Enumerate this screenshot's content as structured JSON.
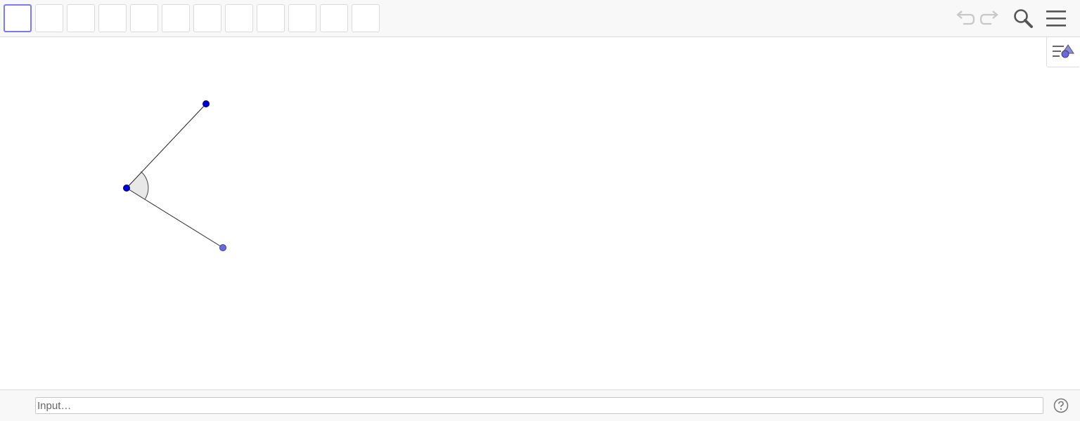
{
  "toolbar": {
    "tools": [
      {
        "name": "tool-1",
        "selected": true
      },
      {
        "name": "tool-2",
        "selected": false
      },
      {
        "name": "tool-3",
        "selected": false
      },
      {
        "name": "tool-4",
        "selected": false
      },
      {
        "name": "tool-5",
        "selected": false
      },
      {
        "name": "tool-6",
        "selected": false
      },
      {
        "name": "tool-7",
        "selected": false
      },
      {
        "name": "tool-8",
        "selected": false
      },
      {
        "name": "tool-9",
        "selected": false
      },
      {
        "name": "tool-10",
        "selected": false
      },
      {
        "name": "tool-11",
        "selected": false
      },
      {
        "name": "tool-12",
        "selected": false
      }
    ],
    "undo_icon": "undo-icon",
    "redo_icon": "redo-icon",
    "search_icon": "search-icon",
    "menu_icon": "hamburger-menu-icon"
  },
  "graphics": {
    "style_bar_icon": "style-bar-toggle-icon",
    "angle_fill": "#e8e8e8",
    "point_color": "#0000cc",
    "free_point_color": "#6a6ae0"
  },
  "input_bar": {
    "placeholder": "Input…",
    "help_icon": "help-icon"
  },
  "colors": {
    "selected_tool_border": "#7b7bf0",
    "toolbar_background": "#f8f8f8"
  }
}
